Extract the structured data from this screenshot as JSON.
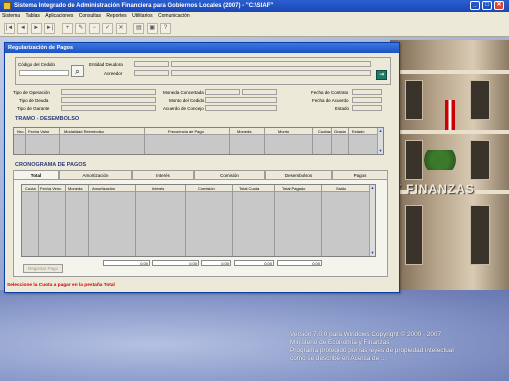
{
  "app": {
    "title": "Sistema Integrado de Administración Financiera para Gobiernos Locales (2007) - \"C:\\SIAF\"",
    "menu": [
      "Sistema",
      "Tablas",
      "Aplicaciones",
      "Consultas",
      "Reportes",
      "Utilitarios",
      "Comunicación"
    ],
    "window_controls": {
      "minimize": "_",
      "maximize": "□",
      "close": "✕"
    }
  },
  "toolbar": {
    "buttons": [
      "|◄",
      "◄",
      "►",
      "►|",
      "+",
      "✎",
      "−",
      "✓",
      "✕",
      "▤",
      "▣",
      "?"
    ]
  },
  "window": {
    "title": "Regularización de Pagos",
    "fields": {
      "codigo_cedido": "Código del Cedido",
      "entidad_deudora": "Entidad Deudora",
      "acreedor": "Acreedor",
      "tipo_operacion": "Tipo de Operación",
      "tipo_deuda": "Tipo de Deuda",
      "tipo_garante": "Tipo de Garante",
      "moneda_concertada": "Moneda Concertada",
      "monto_cedido": "Monto del Cedido",
      "acuerdo_concejo": "Acuerdo de Concejo",
      "fecha_contrato": "Fecha de Contrato",
      "fecha_acuerdo": "Fecha de Acuerdo",
      "estado": "Estado"
    },
    "tramo_title": "TRAMO - DESEMBOLSO",
    "tramo_columns": [
      "Nro.",
      "Fecha Valor",
      "Modalidad Reembolso",
      "Frecuencia de Pago",
      "Moneda",
      "Monto",
      "Cuotas",
      "Gracia",
      "Estado"
    ],
    "cronograma_title": "CRONOGRAMA DE PAGOS",
    "tabs": [
      "Total",
      "Amortización",
      "Interés",
      "Comisión",
      "Desembolsos",
      "Pagos"
    ],
    "cronograma_columns": [
      "Cuota",
      "Fecha Venc.",
      "Moneda",
      "Amortización",
      "Interés",
      "Comisión",
      "Total Cuota",
      "Total Pagado",
      "Saldo"
    ],
    "totals": [
      "0.00",
      "0.00",
      "0.00",
      "0.00",
      "0.00"
    ],
    "registrar_button": "Registrar Pago",
    "status_message": "Seleccione la Cuota a pagar en la pestaña Total"
  },
  "background": {
    "building_text": "Y FINANZAS",
    "version_lines": [
      "Versión 7.0.0 para Windows Copyright © 2000 - 2007",
      "Ministerio de Economía y Finanzas",
      "Programa protegido por las leyes de propiedad intelectual",
      "como se describe en Acerca de ..."
    ]
  }
}
